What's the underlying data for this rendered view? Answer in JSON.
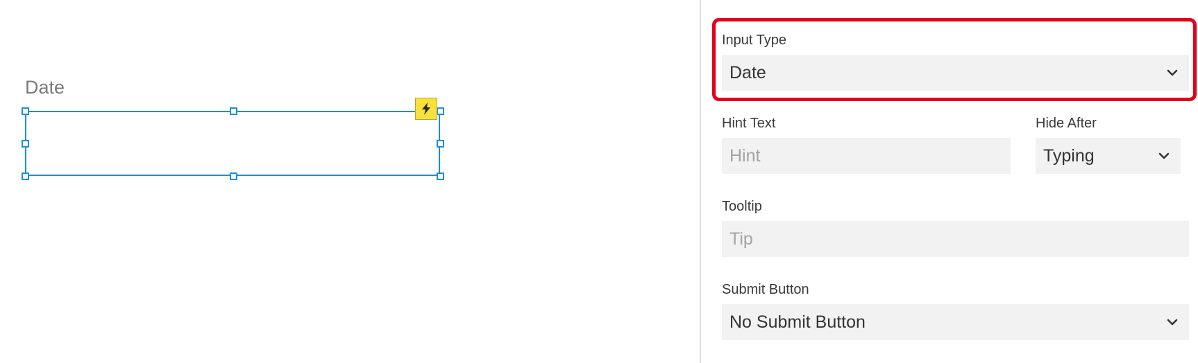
{
  "canvas": {
    "field_label": "Date",
    "icons": {
      "action": "lightning-icon"
    }
  },
  "properties": {
    "input_type": {
      "label": "Input Type",
      "value": "Date"
    },
    "hint_text": {
      "label": "Hint Text",
      "placeholder": "Hint"
    },
    "hide_after": {
      "label": "Hide After",
      "value": "Typing"
    },
    "tooltip": {
      "label": "Tooltip",
      "placeholder": "Tip"
    },
    "submit_button": {
      "label": "Submit Button",
      "value": "No Submit Button"
    }
  },
  "colors": {
    "selection": "#1a8fdc",
    "highlight": "#e3001b",
    "field_bg": "#f2f2f2",
    "bolt_bg": "#f7e13a"
  }
}
